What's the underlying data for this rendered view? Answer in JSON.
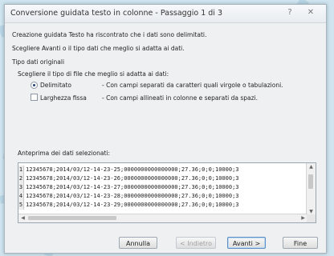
{
  "window": {
    "title": "Conversione guidata testo in colonne - Passaggio 1 di 3",
    "help_symbol": "?",
    "close_symbol": "✕"
  },
  "intro": {
    "line1": "Creazione guidata Testo ha riscontrato che i dati sono delimitati.",
    "line2": "Scegliere Avanti o il tipo dati che meglio si adatta ai dati."
  },
  "original_type": {
    "group_label": "Tipo dati originali",
    "prompt": "Scegliere il tipo di file che meglio si adatta ai dati:",
    "options": [
      {
        "label": "Delimitato",
        "description": "- Con campi separati da caratteri quali virgole o tabulazioni.",
        "selected": true
      },
      {
        "label": "Larghezza fissa",
        "description": "- Con campi allineati in colonne e separati da spazi.",
        "selected": false
      }
    ]
  },
  "preview": {
    "label": "Anteprima dei dati selezionati:",
    "rows": [
      {
        "num": "1",
        "text": "12345678;2014/03/12-14-23-25;0000000000000000;27.36;0;0;10000;3"
      },
      {
        "num": "2",
        "text": "12345678;2014/03/12-14-23-26;0000000000000000;27.36;0;0;10000;3"
      },
      {
        "num": "3",
        "text": "12345678;2014/03/12-14-23-27;0000000000000000;27.36;0;0;10000;3"
      },
      {
        "num": "4",
        "text": "12345678;2014/03/12-14-23-28;0000000000000000;27.36;0;0;10000;3"
      },
      {
        "num": "5",
        "text": "12345678;2014/03/12-14-23-29;0000000000000000;27.36;0;0;10000;3"
      }
    ]
  },
  "buttons": {
    "cancel": "Annulla",
    "back": "< Indietro",
    "next": "Avanti >",
    "finish": "Fine"
  },
  "icons": {
    "radio_selected": "radio-selected-icon",
    "checkbox": "checkbox-icon"
  }
}
